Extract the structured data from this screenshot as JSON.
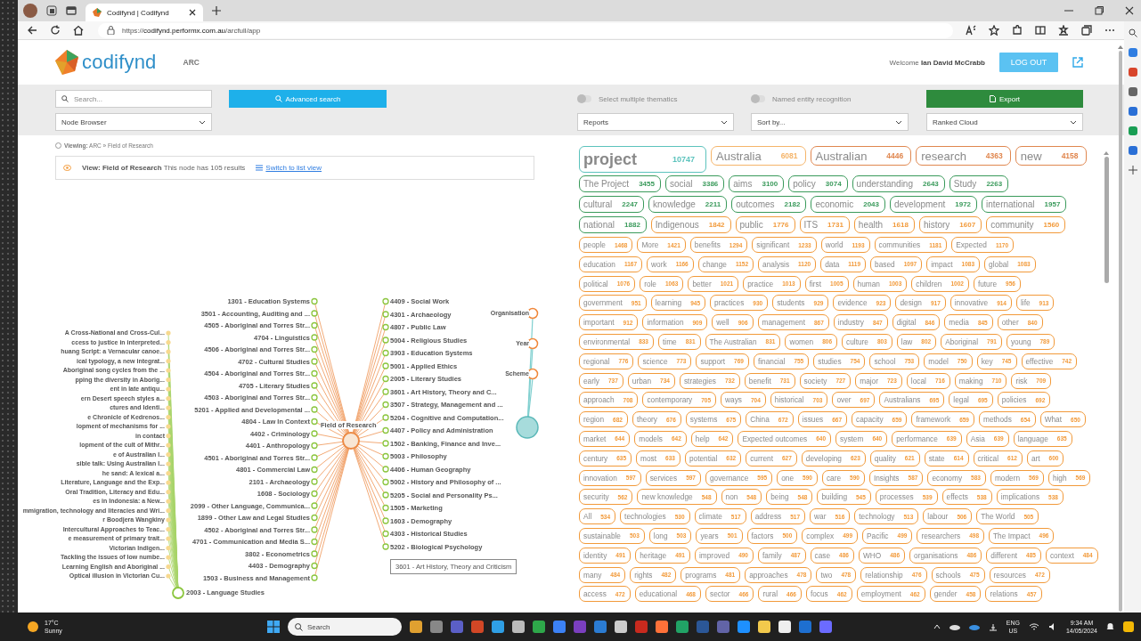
{
  "browser": {
    "tab_title": "Codifynd | Codifynd",
    "url": "https://**codifynd.performx.com.au**/arcfull/app"
  },
  "header": {
    "logo": "codifynd",
    "project": "ARC",
    "welcome": "Welcome **Ian David McCrabb**",
    "logout": "LOG OUT"
  },
  "toolbar": {
    "search": {
      "placeholder": "Search..."
    },
    "advanced_search": "Advanced search",
    "node_browser": "Node Browser",
    "toggles": [
      {
        "label": "Select multiple thematics",
        "on": false
      },
      {
        "label": "Named entity recognition",
        "on": false
      }
    ],
    "export": "Export",
    "reports": "Reports",
    "sort": "Sort by...",
    "view_mode": "Ranked Cloud"
  },
  "breadcrumb": "**Viewing:** ARC » Field of Research",
  "view_info": {
    "text": "**View: Field of Research** This node has 105 results",
    "link": "Switch to list view"
  },
  "graph": {
    "hub": "Field of Research",
    "fields": [
      "1301 - Education Systems",
      "3501 - Accounting, Auditing and ...",
      "4505 - Aboriginal and Torres Str...",
      "4704 - Linguistics",
      "4506 - Aboriginal and Torres Str...",
      "4702 - Cultural Studies",
      "4504 - Aboriginal and Torres Str...",
      "4705 - Literary Studies",
      "4503 - Aboriginal and Torres Str...",
      "5201 - Applied and Developmental ...",
      "4804 - Law In Context",
      "4402 - Criminology",
      "4401 - Anthropology",
      "4501 - Aboriginal and Torres Str...",
      "4801 - Commercial Law",
      "2101 - Archaeology",
      "1608 - Sociology",
      "2099 - Other Language, Communica...",
      "1899 - Other Law and Legal Studies",
      "4502 - Aboriginal and Torres Str...",
      "4701 - Communication and Media S...",
      "3802 - Econometrics",
      "4403 - Demography",
      "1503 - Business and Management",
      "4409 - Social Work",
      "4301 - Archaeology",
      "4807 - Public Law",
      "5004 - Religious Studies",
      "3903 - Education Systems",
      "5001 - Applied Ethics",
      "2005 - Literary Studies",
      "3601 - Art History, Theory and C...",
      "3507 - Strategy, Management and ...",
      "5204 - Cognitive and Computation...",
      "4407 - Policy and Administration",
      "1502 - Banking, Finance and Inve...",
      "5003 - Philosophy",
      "4406 - Human Geography",
      "5002 - History and Philosophy of ...",
      "5205 - Social and Personality Ps...",
      "1505 - Marketing",
      "1603 - Demography",
      "4303 - Historical Studies",
      "5202 - Biological Psychology"
    ],
    "language_hub": "2003 - Language Studies",
    "publications": [
      "A Cross-National and Cross-Cul...",
      "ccess to justice in interpreted...",
      "huang Script: a Vernacular canoe...",
      "ical typology, a new integrat...",
      "Aboriginal song cycles from the ...",
      "pping the diversity in Aborig...",
      "ent in late antiqu...",
      "ern Desert speech styles a...",
      "ctures and Identi...",
      "e Chronicle of Kedrenos...",
      "lopment of mechanisms for ...",
      "in contact",
      "lopment of the cult of Mithr...",
      "e of Australian I...",
      "sible talk: Using Australian I...",
      "he sand: A lexical a...",
      "Literature, Language and the Exp...",
      "Oral Tradition, Literacy and Edu...",
      "es in Indonesia: a New...",
      "mmigration, technology and literacies and Wri...",
      "r Boodjera Wangkiny",
      "Intercultural Approaches to Teac...",
      "e measurement of primary trait...",
      "Victorian Indigen...",
      "Tackling the issues of low numbe...",
      "Learning English and Aboriginal ...",
      "Optical illusion in Victorian Cu..."
    ],
    "facets": [
      "Organisation",
      "Year",
      "Scheme"
    ],
    "tooltip": "3601 - Art History, Theory and Criticism"
  },
  "cloud": {
    "rows": [
      {
        "kind": "lg",
        "color": "#e0874f",
        "tags": [
          {
            "word": "project",
            "count": "10747",
            "kind": "xl",
            "color": "#5cc3bd"
          },
          {
            "word": "Australia",
            "count": "6081",
            "color": "#f5b56a"
          },
          {
            "word": "Australian",
            "count": "4446"
          },
          {
            "word": "research",
            "count": "4363"
          },
          {
            "word": "new",
            "count": "4158"
          }
        ]
      },
      {
        "kind": "md",
        "color": "#3a9a5b",
        "tags": [
          {
            "word": "The Project",
            "count": "3455"
          },
          {
            "word": "social",
            "count": "3386"
          },
          {
            "word": "aims",
            "count": "3100"
          },
          {
            "word": "policy",
            "count": "3074"
          },
          {
            "word": "understanding",
            "count": "2643"
          },
          {
            "word": "Study",
            "count": "2263"
          }
        ]
      },
      {
        "kind": "md",
        "color": "#3a9a5b",
        "tags": [
          {
            "word": "cultural",
            "count": "2247"
          },
          {
            "word": "knowledge",
            "count": "2211"
          },
          {
            "word": "outcomes",
            "count": "2182"
          },
          {
            "word": "economic",
            "count": "2043"
          },
          {
            "word": "development",
            "count": "1972"
          },
          {
            "word": "international",
            "count": "1957"
          }
        ]
      },
      {
        "kind": "md",
        "color": "#f29a3a",
        "tags": [
          {
            "word": "national",
            "count": "1882",
            "color": "#3a9a5b"
          },
          {
            "word": "Indigenous",
            "count": "1842"
          },
          {
            "word": "public",
            "count": "1776"
          },
          {
            "word": "ITS",
            "count": "1731"
          },
          {
            "word": "health",
            "count": "1618"
          },
          {
            "word": "history",
            "count": "1607"
          },
          {
            "word": "community",
            "count": "1560"
          }
        ]
      },
      {
        "kind": "sm",
        "color": "#f29a3a",
        "tags": [
          {
            "word": "people",
            "count": "1468"
          },
          {
            "word": "More",
            "count": "1421"
          },
          {
            "word": "benefits",
            "count": "1294"
          },
          {
            "word": "significant",
            "count": "1233"
          },
          {
            "word": "world",
            "count": "1193"
          },
          {
            "word": "communities",
            "count": "1181"
          },
          {
            "word": "Expected",
            "count": "1170"
          }
        ]
      },
      {
        "kind": "sm",
        "color": "#f29a3a",
        "tags": [
          {
            "word": "education",
            "count": "1167"
          },
          {
            "word": "work",
            "count": "1166"
          },
          {
            "word": "change",
            "count": "1152"
          },
          {
            "word": "analysis",
            "count": "1120"
          },
          {
            "word": "data",
            "count": "1119"
          },
          {
            "word": "based",
            "count": "1097"
          },
          {
            "word": "impact",
            "count": "1083"
          },
          {
            "word": "global",
            "count": "1083"
          }
        ]
      },
      {
        "kind": "sm",
        "color": "#f29a3a",
        "tags": [
          {
            "word": "political",
            "count": "1076"
          },
          {
            "word": "role",
            "count": "1063"
          },
          {
            "word": "better",
            "count": "1021"
          },
          {
            "word": "practice",
            "count": "1013"
          },
          {
            "word": "first",
            "count": "1005"
          },
          {
            "word": "human",
            "count": "1003"
          },
          {
            "word": "children",
            "count": "1002"
          },
          {
            "word": "future",
            "count": "956"
          }
        ]
      },
      {
        "kind": "sm",
        "color": "#f29a3a",
        "tags": [
          {
            "word": "government",
            "count": "951"
          },
          {
            "word": "learning",
            "count": "945"
          },
          {
            "word": "practices",
            "count": "930"
          },
          {
            "word": "students",
            "count": "929"
          },
          {
            "word": "evidence",
            "count": "923"
          },
          {
            "word": "design",
            "count": "917"
          },
          {
            "word": "innovative",
            "count": "914"
          },
          {
            "word": "life",
            "count": "913"
          }
        ]
      },
      {
        "kind": "sm",
        "color": "#f29a3a",
        "tags": [
          {
            "word": "important",
            "count": "912"
          },
          {
            "word": "information",
            "count": "909"
          },
          {
            "word": "well",
            "count": "906"
          },
          {
            "word": "management",
            "count": "867"
          },
          {
            "word": "industry",
            "count": "847"
          },
          {
            "word": "digital",
            "count": "846"
          },
          {
            "word": "media",
            "count": "845"
          },
          {
            "word": "other",
            "count": "840"
          }
        ]
      },
      {
        "kind": "sm",
        "color": "#f29a3a",
        "tags": [
          {
            "word": "environmental",
            "count": "833"
          },
          {
            "word": "time",
            "count": "831"
          },
          {
            "word": "The Australian",
            "count": "831"
          },
          {
            "word": "women",
            "count": "806"
          },
          {
            "word": "culture",
            "count": "803"
          },
          {
            "word": "law",
            "count": "802"
          },
          {
            "word": "Aboriginal",
            "count": "791"
          },
          {
            "word": "young",
            "count": "789"
          }
        ]
      },
      {
        "kind": "sm",
        "color": "#f29a3a",
        "tags": [
          {
            "word": "regional",
            "count": "776"
          },
          {
            "word": "science",
            "count": "773"
          },
          {
            "word": "support",
            "count": "769"
          },
          {
            "word": "financial",
            "count": "755"
          },
          {
            "word": "studies",
            "count": "754"
          },
          {
            "word": "school",
            "count": "753"
          },
          {
            "word": "model",
            "count": "750"
          },
          {
            "word": "key",
            "count": "745"
          },
          {
            "word": "effective",
            "count": "742"
          }
        ]
      },
      {
        "kind": "sm",
        "color": "#f29a3a",
        "tags": [
          {
            "word": "early",
            "count": "737"
          },
          {
            "word": "urban",
            "count": "734"
          },
          {
            "word": "strategies",
            "count": "732"
          },
          {
            "word": "benefit",
            "count": "731"
          },
          {
            "word": "society",
            "count": "727"
          },
          {
            "word": "major",
            "count": "723"
          },
          {
            "word": "local",
            "count": "716"
          },
          {
            "word": "making",
            "count": "710"
          },
          {
            "word": "risk",
            "count": "709"
          }
        ]
      },
      {
        "kind": "sm",
        "color": "#f29a3a",
        "tags": [
          {
            "word": "approach",
            "count": "708"
          },
          {
            "word": "contemporary",
            "count": "705"
          },
          {
            "word": "ways",
            "count": "704"
          },
          {
            "word": "historical",
            "count": "703"
          },
          {
            "word": "over",
            "count": "697"
          },
          {
            "word": "Australians",
            "count": "695"
          },
          {
            "word": "legal",
            "count": "695"
          },
          {
            "word": "policies",
            "count": "692"
          }
        ]
      },
      {
        "kind": "sm",
        "color": "#f29a3a",
        "tags": [
          {
            "word": "region",
            "count": "682"
          },
          {
            "word": "theory",
            "count": "676"
          },
          {
            "word": "systems",
            "count": "675"
          },
          {
            "word": "China",
            "count": "672"
          },
          {
            "word": "issues",
            "count": "667"
          },
          {
            "word": "capacity",
            "count": "659"
          },
          {
            "word": "framework",
            "count": "659"
          },
          {
            "word": "methods",
            "count": "654"
          },
          {
            "word": "What",
            "count": "650"
          }
        ]
      },
      {
        "kind": "sm",
        "color": "#f29a3a",
        "tags": [
          {
            "word": "market",
            "count": "644"
          },
          {
            "word": "models",
            "count": "642"
          },
          {
            "word": "help",
            "count": "642"
          },
          {
            "word": "Expected outcomes",
            "count": "640"
          },
          {
            "word": "system",
            "count": "640"
          },
          {
            "word": "performance",
            "count": "639"
          },
          {
            "word": "Asia",
            "count": "639"
          },
          {
            "word": "language",
            "count": "635"
          }
        ]
      },
      {
        "kind": "sm",
        "color": "#f29a3a",
        "tags": [
          {
            "word": "century",
            "count": "635"
          },
          {
            "word": "most",
            "count": "633"
          },
          {
            "word": "potential",
            "count": "632"
          },
          {
            "word": "current",
            "count": "627"
          },
          {
            "word": "developing",
            "count": "623"
          },
          {
            "word": "quality",
            "count": "621"
          },
          {
            "word": "state",
            "count": "614"
          },
          {
            "word": "critical",
            "count": "612"
          },
          {
            "word": "art",
            "count": "600"
          }
        ]
      },
      {
        "kind": "sm",
        "color": "#f29a3a",
        "tags": [
          {
            "word": "innovation",
            "count": "597"
          },
          {
            "word": "services",
            "count": "597"
          },
          {
            "word": "governance",
            "count": "595"
          },
          {
            "word": "one",
            "count": "590"
          },
          {
            "word": "care",
            "count": "590"
          },
          {
            "word": "Insights",
            "count": "587"
          },
          {
            "word": "economy",
            "count": "583"
          },
          {
            "word": "modern",
            "count": "569"
          },
          {
            "word": "high",
            "count": "569"
          }
        ]
      },
      {
        "kind": "sm",
        "color": "#f29a3a",
        "tags": [
          {
            "word": "security",
            "count": "562"
          },
          {
            "word": "new knowledge",
            "count": "548"
          },
          {
            "word": "non",
            "count": "548"
          },
          {
            "word": "being",
            "count": "548"
          },
          {
            "word": "building",
            "count": "545"
          },
          {
            "word": "processes",
            "count": "539"
          },
          {
            "word": "effects",
            "count": "538"
          },
          {
            "word": "implications",
            "count": "538"
          }
        ]
      },
      {
        "kind": "sm",
        "color": "#f29a3a",
        "tags": [
          {
            "word": "All",
            "count": "534"
          },
          {
            "word": "technologies",
            "count": "530"
          },
          {
            "word": "climate",
            "count": "517"
          },
          {
            "word": "address",
            "count": "517"
          },
          {
            "word": "war",
            "count": "516"
          },
          {
            "word": "technology",
            "count": "513"
          },
          {
            "word": "labour",
            "count": "506"
          },
          {
            "word": "The World",
            "count": "505"
          }
        ]
      },
      {
        "kind": "sm",
        "color": "#f29a3a",
        "tags": [
          {
            "word": "sustainable",
            "count": "503"
          },
          {
            "word": "long",
            "count": "503"
          },
          {
            "word": "years",
            "count": "501"
          },
          {
            "word": "factors",
            "count": "500"
          },
          {
            "word": "complex",
            "count": "499"
          },
          {
            "word": "Pacific",
            "count": "499"
          },
          {
            "word": "researchers",
            "count": "498"
          },
          {
            "word": "The Impact",
            "count": "496"
          }
        ]
      },
      {
        "kind": "sm",
        "color": "#f29a3a",
        "tags": [
          {
            "word": "identity",
            "count": "491"
          },
          {
            "word": "heritage",
            "count": "491"
          },
          {
            "word": "improved",
            "count": "490"
          },
          {
            "word": "family",
            "count": "487"
          },
          {
            "word": "case",
            "count": "486"
          },
          {
            "word": "WHO",
            "count": "486"
          },
          {
            "word": "organisations",
            "count": "486"
          },
          {
            "word": "different",
            "count": "485"
          },
          {
            "word": "context",
            "count": "484"
          }
        ]
      },
      {
        "kind": "sm",
        "color": "#f29a3a",
        "tags": [
          {
            "word": "many",
            "count": "484"
          },
          {
            "word": "rights",
            "count": "482"
          },
          {
            "word": "programs",
            "count": "481"
          },
          {
            "word": "approaches",
            "count": "478"
          },
          {
            "word": "two",
            "count": "478"
          },
          {
            "word": "relationship",
            "count": "476"
          },
          {
            "word": "schools",
            "count": "475"
          },
          {
            "word": "resources",
            "count": "472"
          }
        ]
      },
      {
        "kind": "sm",
        "color": "#f29a3a",
        "tags": [
          {
            "word": "access",
            "count": "472"
          },
          {
            "word": "educational",
            "count": "468"
          },
          {
            "word": "sector",
            "count": "466"
          },
          {
            "word": "rural",
            "count": "466"
          },
          {
            "word": "focus",
            "count": "462"
          },
          {
            "word": "employment",
            "count": "462"
          },
          {
            "word": "gender",
            "count": "458"
          },
          {
            "word": "relations",
            "count": "457"
          }
        ]
      }
    ]
  },
  "taskbar": {
    "weather": {
      "temperature": "17°C",
      "condition": "Sunny"
    },
    "search": {
      "placeholder": "Search"
    },
    "language": "ENG",
    "region": "US",
    "time": "9:34 AM",
    "date": "14/05/2024"
  }
}
